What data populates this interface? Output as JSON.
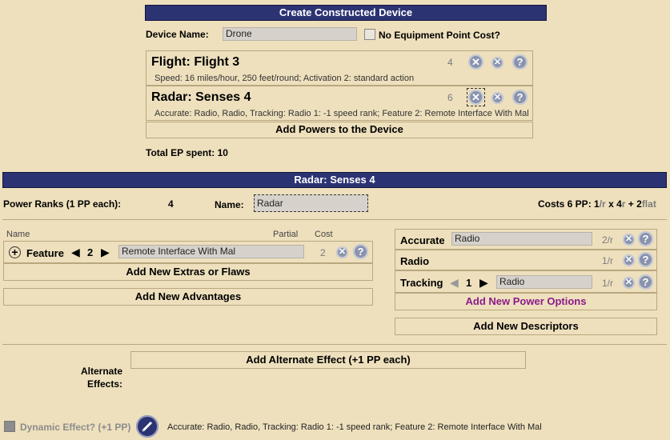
{
  "device": {
    "header": "Create Constructed Device",
    "name_label": "Device Name:",
    "name_value": "Drone",
    "no_ep_label": "No Equipment Point Cost?",
    "powers": [
      {
        "title": "Flight: Flight 3",
        "cost": "4",
        "desc": "Speed: 16 miles/hour, 250 feet/round; Activation 2: standard action"
      },
      {
        "title": "Radar: Senses 4",
        "cost": "6",
        "desc": "Accurate: Radio, Radio, Tracking: Radio 1: -1 speed rank; Feature 2: Remote Interface With Mal"
      }
    ],
    "add_powers": "Add Powers to the Device",
    "total_ep": "Total EP spent: 10"
  },
  "power": {
    "header": "Radar: Senses 4",
    "ranks_label": "Power Ranks (1 PP each):",
    "ranks_value": "4",
    "name_label": "Name:",
    "name_value": "Radar",
    "costs_prefix": "Costs 6 PP:",
    "costs_1": "1",
    "costs_r1": "/r",
    "costs_x": " x ",
    "costs_4": "4",
    "costs_r2": "r",
    "costs_plus": " + ",
    "costs_2": "2",
    "costs_flat": "flat"
  },
  "modifiers": {
    "col_name": "Name",
    "col_partial": "Partial",
    "col_cost": "Cost",
    "rows": [
      {
        "name": "Feature",
        "rank": "2",
        "value": "Remote Interface With Mal",
        "cost": "2"
      }
    ],
    "add_extras": "Add New Extras or Flaws",
    "add_advantages": "Add New Advantages"
  },
  "options": {
    "rows": [
      {
        "label": "Accurate",
        "value": "Radio",
        "cost": "2/r"
      },
      {
        "label": "Radio",
        "cost": "1/r"
      },
      {
        "label": "Tracking",
        "rank": "1",
        "value": "Radio",
        "cost": "1/r"
      }
    ],
    "add_power_options": "Add New Power Options",
    "add_descriptors": "Add New Descriptors"
  },
  "alternate": {
    "add_label": "Add Alternate Effect (+1 PP each)",
    "label_1": "Alternate",
    "label_2": "Effects:"
  },
  "footer": {
    "dynamic_label": "Dynamic Effect? (+1 PP)",
    "summary": "Accurate: Radio, Radio, Tracking: Radio 1: -1 speed rank; Feature 2: Remote Interface With Mal"
  },
  "colors": {
    "header_bg": "#2c3373",
    "page_bg": "#eee0bd",
    "options_link": "#8b1a8b"
  }
}
